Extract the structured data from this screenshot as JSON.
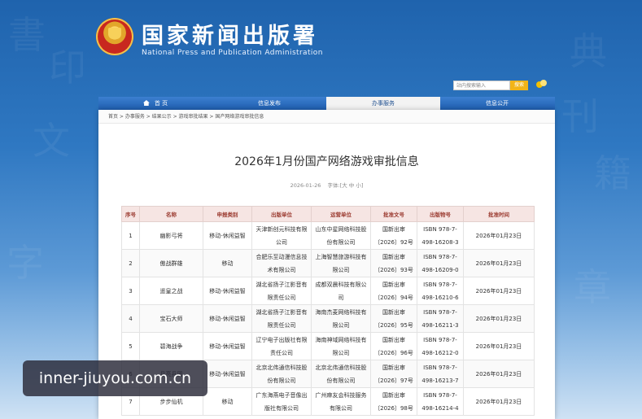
{
  "header": {
    "title": "国家新闻出版署",
    "subtitle": "National Press and Publication Administration",
    "search_placeholder": "站内搜索输入",
    "search_button": "搜索"
  },
  "nav": {
    "items": [
      {
        "label": "首 页",
        "icon": "home-icon"
      },
      {
        "label": "信息发布"
      },
      {
        "label": "办事服务",
        "active": true
      },
      {
        "label": "信息公开"
      }
    ]
  },
  "breadcrumb": "首页 > 办事服务 > 结果公示 > 游戏审批结果 > 国产网络游戏审批信息",
  "article": {
    "title": "2026年1月份国产网络游戏审批信息",
    "date": "2026-01-26",
    "font_size_label": "字体:[大 中 小]"
  },
  "table": {
    "headers": [
      "序号",
      "名称",
      "申报类别",
      "出版单位",
      "运营单位",
      "批准文号",
      "出版物号",
      "批准时间"
    ],
    "rows": [
      [
        "1",
        "幽影弓将",
        "移动-休闲益智",
        "天津新创元科技有限公司",
        "山东中星网络科技股份有限公司",
        "国新出审〔2026〕92号",
        "ISBN 978-7-498-16208-3",
        "2026年01月23日"
      ],
      [
        "2",
        "傲战群雄",
        "移动",
        "合肥乐至动漫信息技术有限公司",
        "上海智慧旅游科技有限公司",
        "国新出审〔2026〕93号",
        "ISBN 978-7-498-16209-0",
        "2026年01月23日"
      ],
      [
        "3",
        "遥皇之战",
        "移动-休闲益智",
        "湖北省扬子江影音有限责任公司",
        "成都双晨科技有限公司",
        "国新出审〔2026〕94号",
        "ISBN 978-7-498-16210-6",
        "2026年01月23日"
      ],
      [
        "4",
        "宝石大师",
        "移动-休闲益智",
        "湖北省扬子江影音有限责任公司",
        "海南杰麦网络科技有限公司",
        "国新出审〔2026〕95号",
        "ISBN 978-7-498-16211-3",
        "2026年01月23日"
      ],
      [
        "5",
        "碧海战争",
        "移动-休闲益智",
        "辽宁电子出版社有限责任公司",
        "海南神域网络科技有限公司",
        "国新出审〔2026〕96号",
        "ISBN 978-7-498-16212-0",
        "2026年01月23日"
      ],
      [
        "6",
        "月亮兵团",
        "移动-休闲益智",
        "北京北伟通信科技股份有限公司",
        "北京北伟通信科技股份有限公司",
        "国新出审〔2026〕97号",
        "ISBN 978-7-498-16213-7",
        "2026年01月23日"
      ],
      [
        "7",
        "步步仙机",
        "移动",
        "广东海燕电子音像出版社有限公司",
        "广州麻友会科技服务有限公司",
        "国新出审〔2026〕98号",
        "ISBN 978-7-498-16214-4",
        "2026年01月23日"
      ]
    ]
  },
  "watermark": "inner-jiuyou.com.cn",
  "colors": {
    "nav_bg": "#1f5eaf",
    "table_header_bg": "#f6e5e3",
    "table_header_text": "#9b3a2f",
    "search_button": "#f2b418"
  }
}
